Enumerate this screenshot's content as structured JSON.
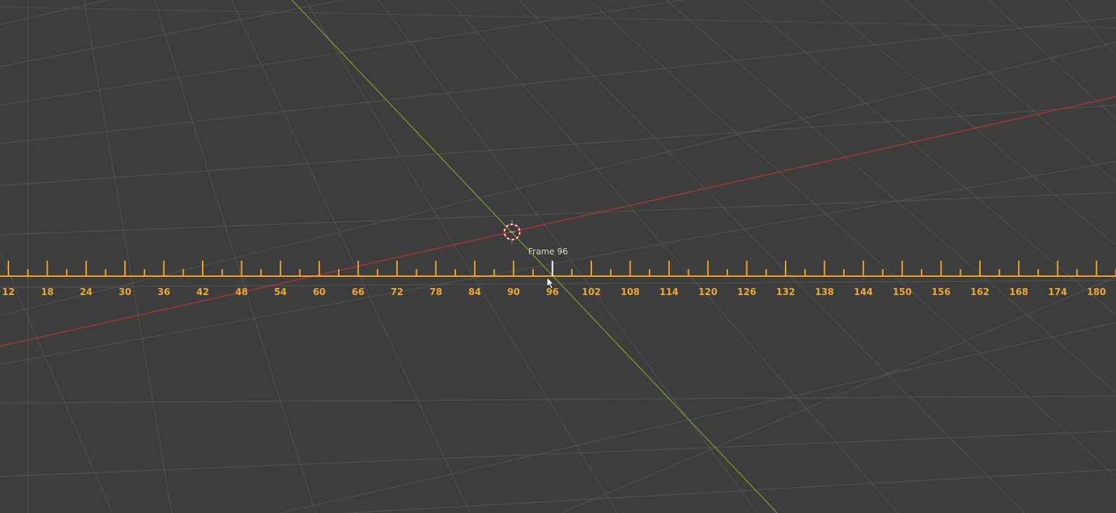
{
  "app": {
    "view": "3d-viewport"
  },
  "colors": {
    "background": "#3d3d3d",
    "grid": "#5a5a5a",
    "axis_x": "#b8323a",
    "axis_y": "#7aa82a",
    "ruler": "#f0a830",
    "frame_label": "#e8e0c8",
    "cursor": "#ffffff"
  },
  "timeline_overlay": {
    "current_frame_label": "Frame 96",
    "current_frame": 96,
    "major_step": 6,
    "minor_step": 3,
    "tick_labels": [
      "12",
      "18",
      "24",
      "30",
      "36",
      "42",
      "48",
      "54",
      "60",
      "66",
      "72",
      "78",
      "84",
      "90",
      "96",
      "102",
      "108",
      "114",
      "120",
      "126",
      "132",
      "138",
      "144",
      "150",
      "156",
      "162",
      "168",
      "174",
      "180"
    ]
  },
  "icons": {
    "origin": "3d-cursor-icon",
    "pointer": "mouse-pointer-icon"
  }
}
